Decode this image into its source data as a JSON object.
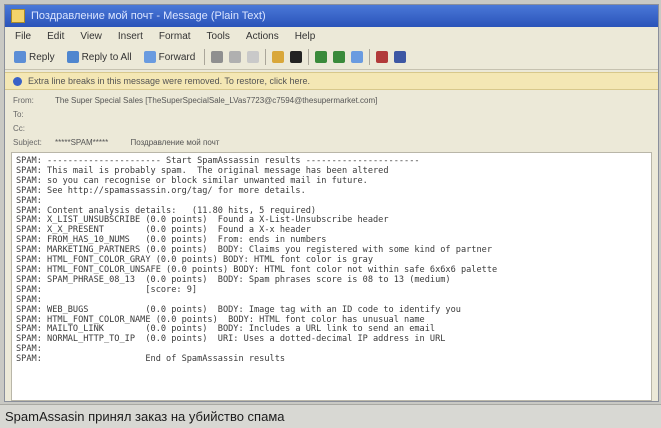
{
  "window": {
    "title": "Поздравление мой почт - Message (Plain Text)"
  },
  "menu": [
    "File",
    "Edit",
    "View",
    "Insert",
    "Format",
    "Tools",
    "Actions",
    "Help"
  ],
  "toolbar": {
    "reply": "Reply",
    "reply_all": "Reply to All",
    "forward": "Forward"
  },
  "infobar": {
    "text": "Extra line breaks in this message were removed. To restore, click here."
  },
  "headers": {
    "from_label": "From:",
    "from_value": "The Super Special Sales [TheSuperSpecialSale_LVas7723@c7594@thesupermarket.com]",
    "to_label": "To:",
    "cc_label": "Cc:",
    "subject_label": "Subject:",
    "subject_value": "*****SPAM*****          Поздравление мой почт"
  },
  "body_lines": [
    "SPAM: ---------------------- Start SpamAssassin results ----------------------",
    "SPAM: This mail is probably spam.  The original message has been altered",
    "SPAM: so you can recognise or block similar unwanted mail in future.",
    "SPAM: See http://spamassassin.org/tag/ for more details.",
    "SPAM:",
    "SPAM: Content analysis details:   (11.80 hits, 5 required)",
    "SPAM: X_LIST_UNSUBSCRIBE (0.0 points)  Found a X-List-Unsubscribe header",
    "SPAM: X_X_PRESENT        (0.0 points)  Found a X-x header",
    "SPAM: FROM_HAS_10_NUMS   (0.0 points)  From: ends in numbers",
    "SPAM: MARKETING_PARTNERS (0.0 points)  BODY: Claims you registered with some kind of partner",
    "SPAM: HTML_FONT_COLOR_GRAY (0.0 points) BODY: HTML font color is gray",
    "SPAM: HTML_FONT_COLOR_UNSAFE (0.0 points) BODY: HTML font color not within safe 6x6x6 palette",
    "SPAM: SPAM_PHRASE_08_13  (0.0 points)  BODY: Spam phrases score is 08 to 13 (medium)",
    "SPAM:                    [score: 9]",
    "SPAM:",
    "SPAM: WEB_BUGS           (0.0 points)  BODY: Image tag with an ID code to identify you",
    "SPAM: HTML_FONT_COLOR_NAME (0.0 points)  BODY: HTML font color has unusual name",
    "SPAM: MAILTO_LINK        (0.0 points)  BODY: Includes a URL link to send an email",
    "SPAM: NORMAL_HTTP_TO_IP  (0.0 points)  URI: Uses a dotted-decimal IP address in URL",
    "SPAM:",
    "SPAM:                    End of SpamAssassin results"
  ],
  "caption": "SpamAssasin принял заказ на убийство спама"
}
